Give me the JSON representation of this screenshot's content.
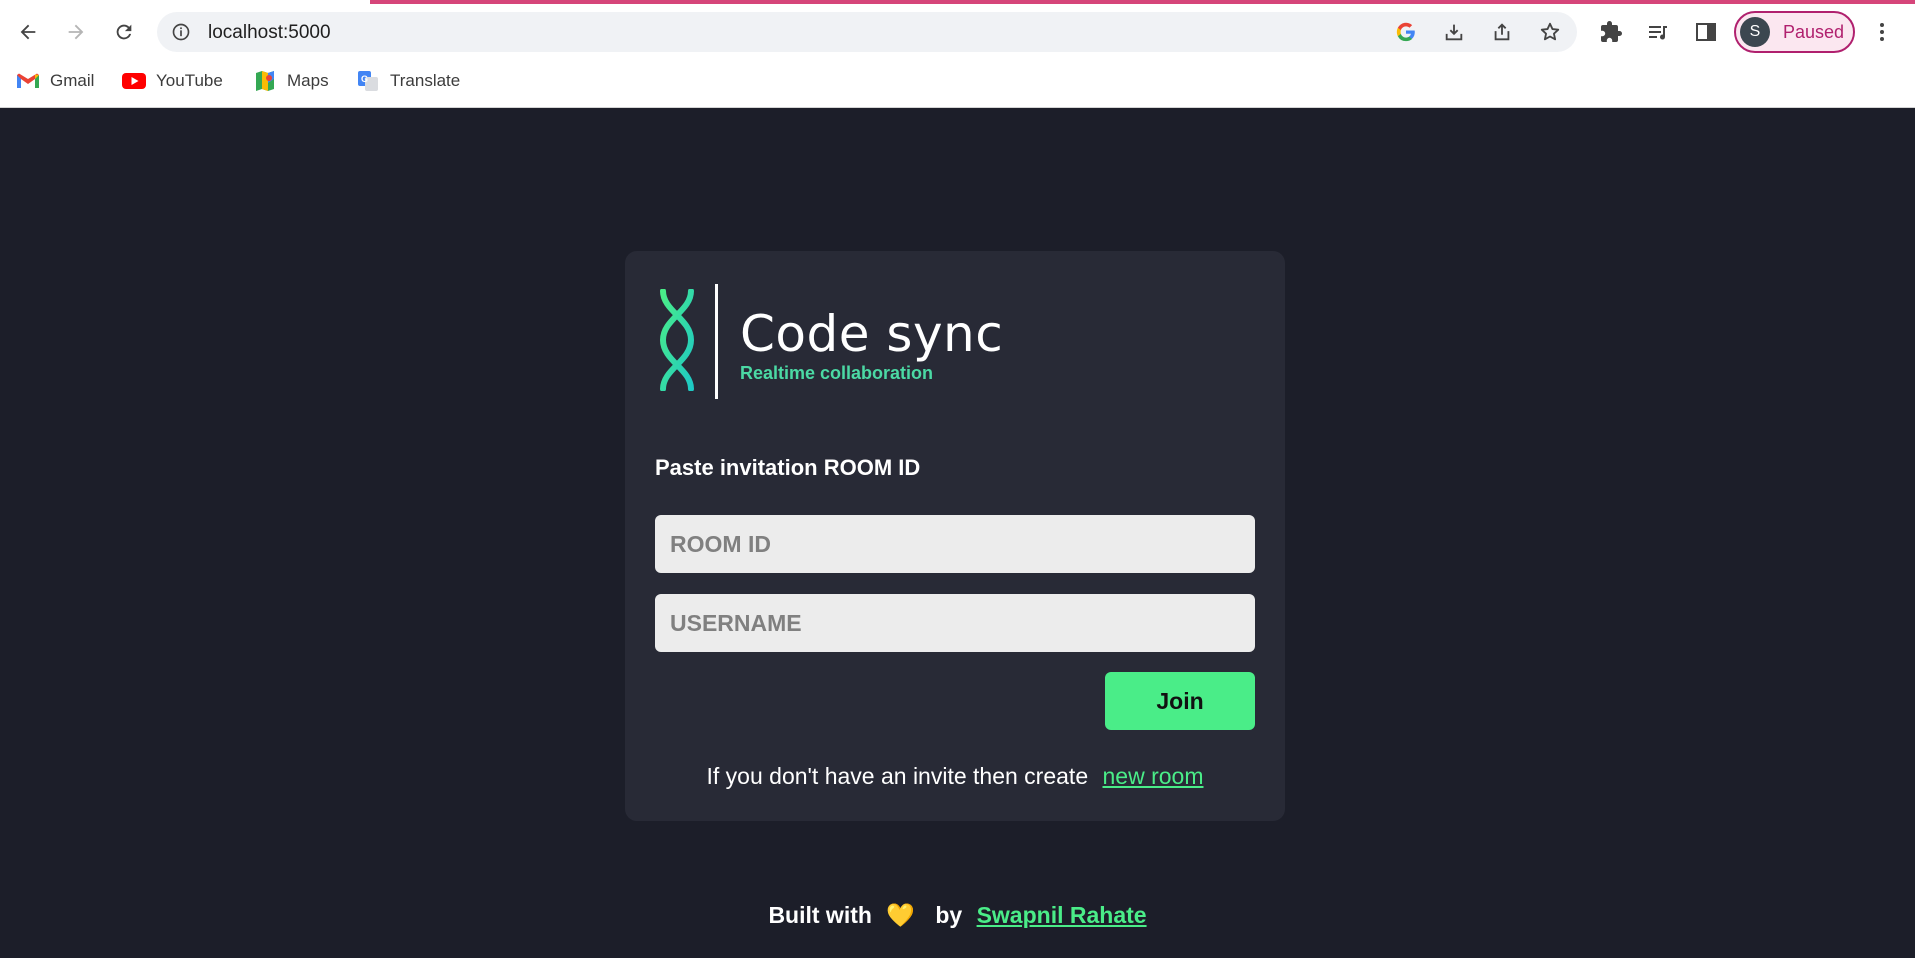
{
  "browser": {
    "url": "localhost:5000",
    "profile_initial": "S",
    "profile_status": "Paused",
    "bookmarks": [
      {
        "label": "Gmail",
        "icon": "gmail-icon"
      },
      {
        "label": "YouTube",
        "icon": "youtube-icon"
      },
      {
        "label": "Maps",
        "icon": "maps-icon"
      },
      {
        "label": "Translate",
        "icon": "translate-icon"
      }
    ]
  },
  "app": {
    "logo_title": "Code sync",
    "logo_subtitle": "Realtime collaboration",
    "heading": "Paste invitation ROOM ID",
    "room_id_placeholder": "ROOM ID",
    "room_id_value": "",
    "username_placeholder": "USERNAME",
    "username_value": "",
    "join_label": "Join",
    "create_text": "If you don't have an invite then create",
    "create_link": "new room"
  },
  "footer": {
    "built_with": "Built with",
    "heart": "💛",
    "by": "by",
    "author": "Swapnil Rahate"
  },
  "colors": {
    "page_bg": "#1c1e29",
    "card_bg": "#282a36",
    "accent": "#4aed88",
    "subtitle": "#4bd9a4",
    "profile": "#b0206e"
  }
}
